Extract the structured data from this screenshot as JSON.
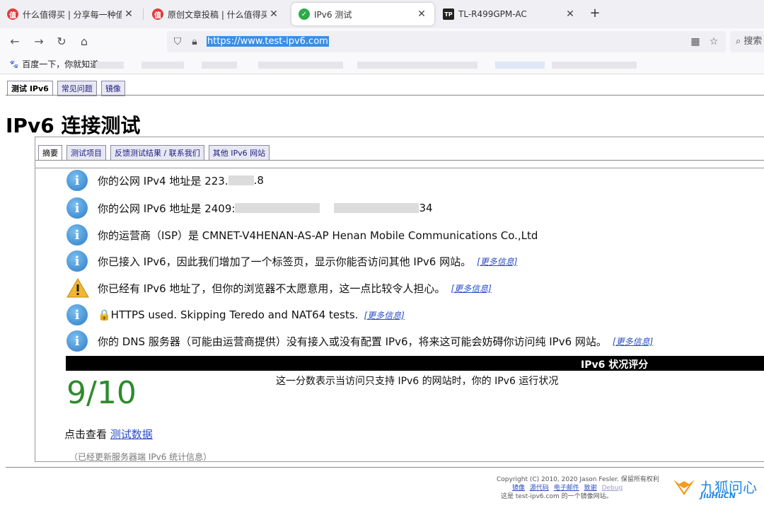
{
  "browser": {
    "tabs": [
      {
        "label": "什么值得买 | 分享每一种值",
        "favicon": "smzdm-icon",
        "color": "#e03b3b"
      },
      {
        "label": "原创文章投稿 | 什么值得买",
        "favicon": "smzdm-icon",
        "color": "#e03b3b"
      },
      {
        "label": "IPv6 测试",
        "favicon": "check-icon",
        "color": "#2eaa4b"
      },
      {
        "label": "TL-R499GPM-AC",
        "favicon": "tplink-icon",
        "color": "#222222"
      }
    ],
    "url": "https://www.test-ipv6.com",
    "search_placeholder": "搜索",
    "bookmark": "百度一下，你就知道"
  },
  "page": {
    "tabs": [
      "测试 IPv6",
      "常见问题",
      "镜像"
    ],
    "title": "IPv6 连接测试",
    "inner_tabs": [
      "摘要",
      "测试项目",
      "反馈测试结果 / 联系我们",
      "其他 IPv6 网站"
    ],
    "results": [
      {
        "type": "info",
        "prefix": "你的公网 IPv4 地址是 223.",
        "suffix": ".8",
        "more": ""
      },
      {
        "type": "info",
        "prefix": "你的公网 IPv6 地址是 2409:",
        "suffix": "34",
        "more": ""
      },
      {
        "type": "info",
        "prefix": "你的运营商（ISP）是 CMNET-V4HENAN-AS-AP Henan Mobile Communications Co.,Ltd",
        "suffix": "",
        "more": ""
      },
      {
        "type": "info",
        "prefix": "你已接入 IPv6，因此我们增加了一个标签页，显示你能否访问其他 IPv6 网站。",
        "suffix": "",
        "more": "[更多信息]"
      },
      {
        "type": "warn",
        "prefix": "你已经有 IPv6 地址了，但你的浏览器不太愿意用，这一点比较令人担心。",
        "suffix": "",
        "more": "[更多信息]"
      },
      {
        "type": "info",
        "prefix": "🔒HTTPS used. Skipping Teredo and NAT64 tests.",
        "suffix": "",
        "more": "[更多信息]"
      },
      {
        "type": "info",
        "prefix": "你的 DNS 服务器（可能由运营商提供）没有接入或没有配置 IPv6，将来这可能会妨碍你访问纯 IPv6 网站。",
        "suffix": "",
        "more": "[更多信息]"
      }
    ],
    "score_heading": "IPv6 状况评分",
    "score": "9/10",
    "score_desc": "这一分数表示当访问只支持 IPv6 的网站时，你的 IPv6 运行状况",
    "test_data_prefix": "点击查看",
    "test_data_link": "测试数据",
    "updated": "（已经更新服务器端 IPv6 统计信息）"
  },
  "footer": {
    "copyright": "Copyright (C) 2010, 2020 Jason Fesler. 保留所有权利",
    "links": [
      "镜像",
      "源代码",
      "电子邮件",
      "致谢",
      "Debug"
    ],
    "mirror_note": "这是 test-ipv6.com 的一个镜像网站。",
    "watermark": "九狐问心",
    "watermark_sub": "JiuHuCN"
  }
}
